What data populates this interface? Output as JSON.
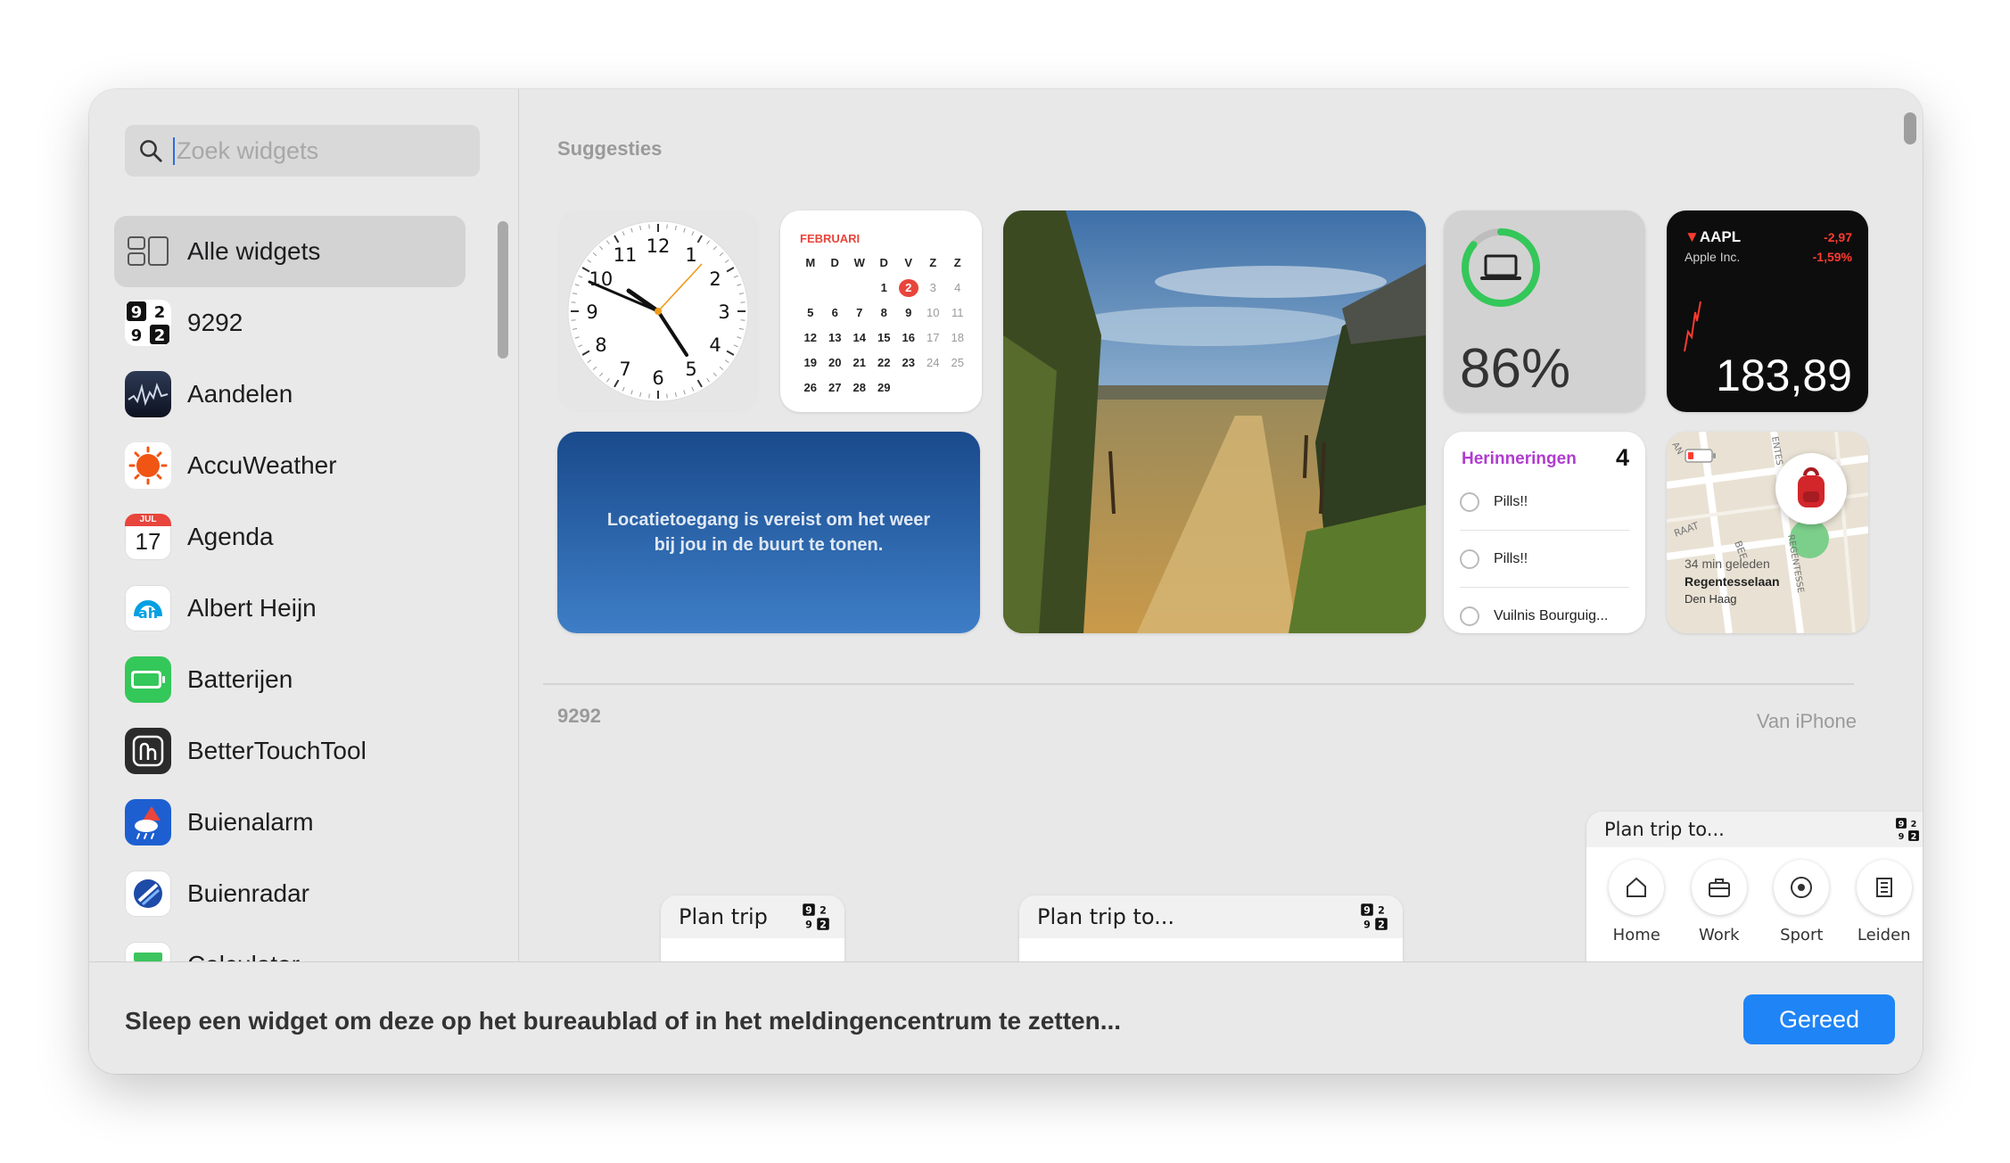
{
  "search": {
    "placeholder": "Zoek widgets"
  },
  "sidebar": {
    "items": [
      {
        "label": "Alle widgets",
        "icon": "widgets-grid-icon"
      },
      {
        "label": "9292",
        "icon": "9292-app-icon"
      },
      {
        "label": "Aandelen",
        "icon": "stocks-app-icon"
      },
      {
        "label": "AccuWeather",
        "icon": "accuweather-app-icon"
      },
      {
        "label": "Agenda",
        "icon": "calendar-app-icon",
        "icon_month": "JUL",
        "icon_day": "17"
      },
      {
        "label": "Albert Heijn",
        "icon": "albert-heijn-app-icon"
      },
      {
        "label": "Batterijen",
        "icon": "battery-app-icon"
      },
      {
        "label": "BetterTouchTool",
        "icon": "bettertouchtool-app-icon"
      },
      {
        "label": "Buienalarm",
        "icon": "buienalarm-app-icon"
      },
      {
        "label": "Buienradar",
        "icon": "buienradar-app-icon"
      },
      {
        "label": "Calculator",
        "icon": "calculator-app-icon"
      }
    ]
  },
  "suggestions": {
    "title": "Suggesties",
    "clock": {
      "numerals": [
        "12",
        "1",
        "2",
        "3",
        "4",
        "5",
        "6",
        "7",
        "8",
        "9",
        "10",
        "11"
      ]
    },
    "calendar": {
      "month": "FEBRUARI",
      "weekdays": [
        "M",
        "D",
        "W",
        "D",
        "V",
        "Z",
        "Z"
      ],
      "today": "2",
      "weeks": [
        [
          "",
          "",
          "",
          "1",
          "2",
          "3",
          "4"
        ],
        [
          "5",
          "6",
          "7",
          "8",
          "9",
          "10",
          "11"
        ],
        [
          "12",
          "13",
          "14",
          "15",
          "16",
          "17",
          "18"
        ],
        [
          "19",
          "20",
          "21",
          "22",
          "23",
          "24",
          "25"
        ],
        [
          "26",
          "27",
          "28",
          "29",
          "",
          "",
          ""
        ]
      ]
    },
    "weather": {
      "message": "Locatietoegang is vereist om het weer bij jou in de buurt te tonen."
    },
    "battery": {
      "percent": "86%",
      "level": 0.86
    },
    "stocks": {
      "symbol": "AAPL",
      "company": "Apple Inc.",
      "change": "-2,97",
      "change_pct": "-1,59%",
      "price": "183,89"
    },
    "reminders": {
      "title": "Herinneringen",
      "count": "4",
      "items": [
        "Pills!!",
        "Pills!!",
        "Vuilnis Bourguig..."
      ]
    },
    "findmy": {
      "time": "34 min geleden",
      "street": "Regentesselaan",
      "city": "Den Haag",
      "map_labels": [
        "RAAT",
        "BEE",
        "REGENTESSE",
        "ENTES",
        "AN"
      ]
    }
  },
  "section_9292": {
    "title": "9292",
    "source": "Van iPhone",
    "small": {
      "title": "Plan trip"
    },
    "medium": {
      "title": "Plan trip to..."
    },
    "large": {
      "title": "Plan trip to...",
      "destinations": [
        {
          "label": "Home",
          "icon": "home-icon"
        },
        {
          "label": "Work",
          "icon": "briefcase-icon"
        },
        {
          "label": "Sport",
          "icon": "football-icon"
        },
        {
          "label": "Leiden",
          "icon": "building-icon"
        }
      ]
    }
  },
  "footer": {
    "hint": "Sleep een widget om deze op het bureaublad of in het meldingencentrum te zetten...",
    "done_label": "Gereed"
  },
  "colors": {
    "accent": "#1f84f5",
    "reminders_accent": "#b03bd0",
    "stock_down": "#ff3b30",
    "battery_ring": "#34c759"
  }
}
